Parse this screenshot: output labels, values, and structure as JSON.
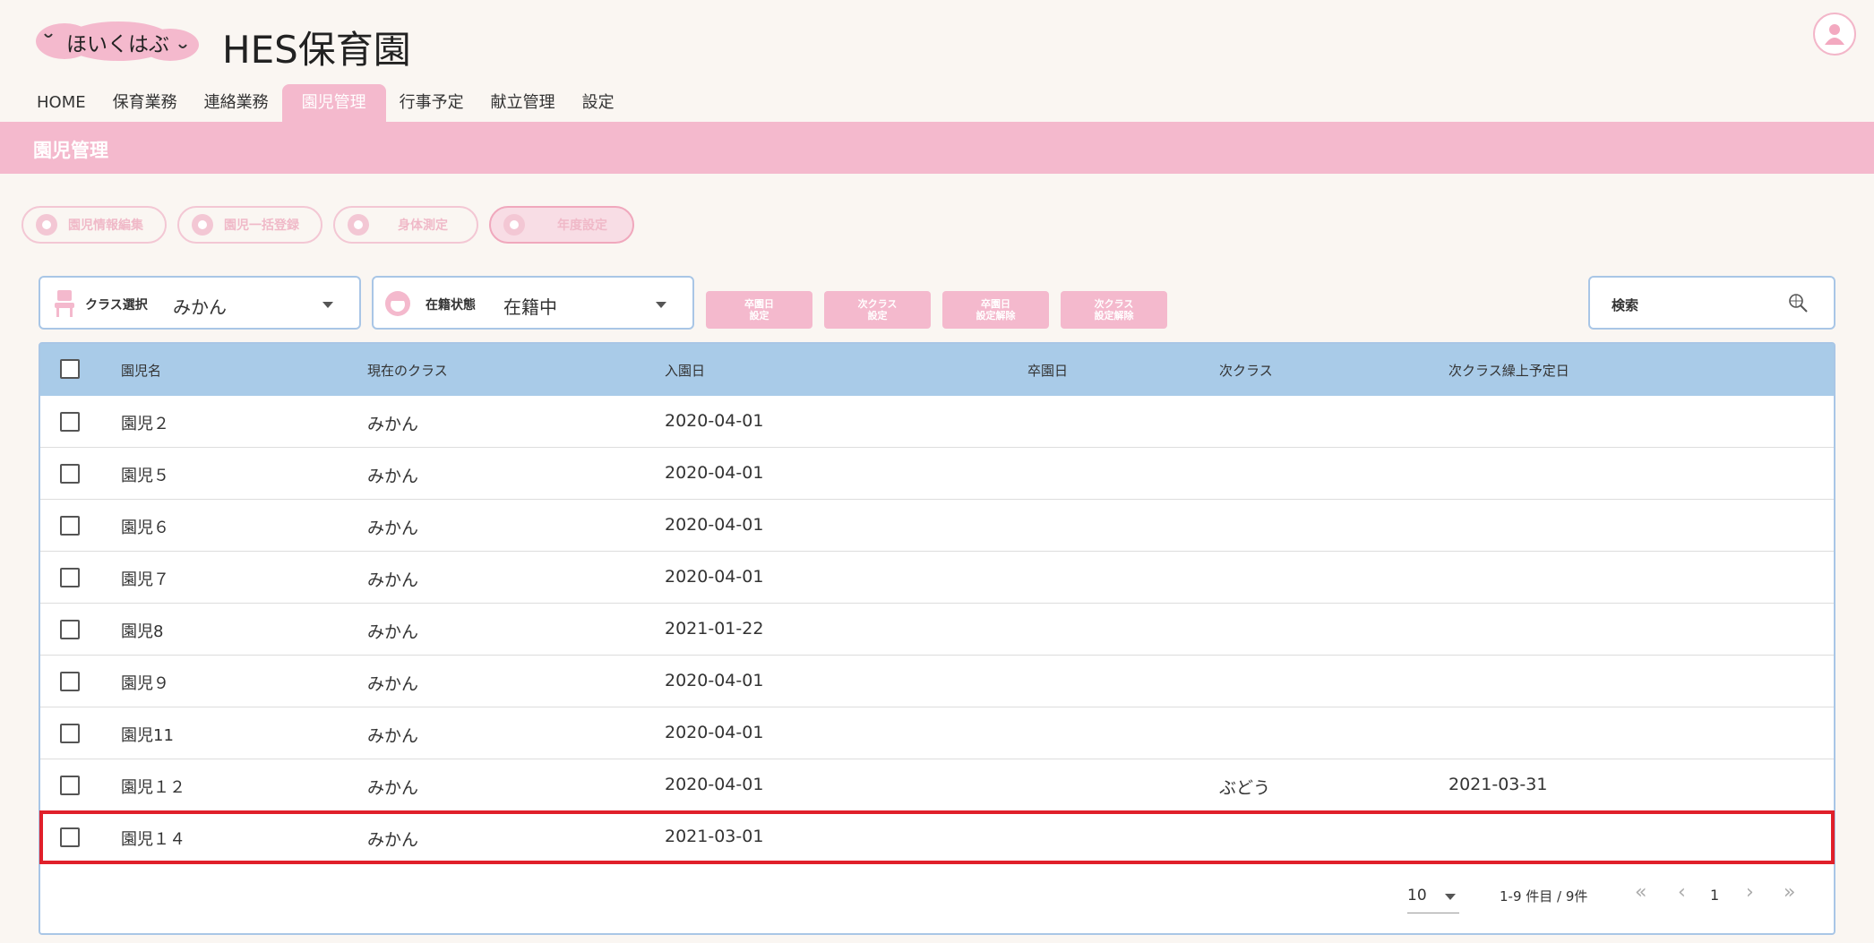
{
  "header": {
    "logo_text": "ほいくはぶ",
    "site_title": "HES保育園"
  },
  "nav": {
    "items": [
      {
        "label": "HOME"
      },
      {
        "label": "保育業務"
      },
      {
        "label": "連絡業務"
      },
      {
        "label": "園児管理",
        "active": true
      },
      {
        "label": "行事予定"
      },
      {
        "label": "献立管理"
      },
      {
        "label": "設定"
      }
    ]
  },
  "banner": {
    "title": "園児管理"
  },
  "actions": {
    "edit_label": "園児情報編集",
    "bulk_label": "園児一括登録",
    "measure_label": "身体測定",
    "year_label": "年度設定"
  },
  "filters": {
    "class_label": "クラス選択",
    "class_value": "みかん",
    "status_label": "在籍状態",
    "status_value": "在籍中"
  },
  "buttons": {
    "graduation_set": [
      "卒園日",
      "設定"
    ],
    "next_class_set": [
      "次クラス",
      "設定"
    ],
    "graduation_clear": [
      "卒園日",
      "設定解除"
    ],
    "next_class_clear": [
      "次クラス",
      "設定解除"
    ]
  },
  "search": {
    "label": "検索"
  },
  "table": {
    "columns": [
      "園児名",
      "現在のクラス",
      "入園日",
      "卒園日",
      "次クラス",
      "次クラス繰上予定日"
    ],
    "rows": [
      {
        "name": "園児２",
        "class": "みかん",
        "entry": "2020-04-01",
        "grad": "",
        "next": "",
        "next_date": ""
      },
      {
        "name": "園児５",
        "class": "みかん",
        "entry": "2020-04-01",
        "grad": "",
        "next": "",
        "next_date": ""
      },
      {
        "name": "園児６",
        "class": "みかん",
        "entry": "2020-04-01",
        "grad": "",
        "next": "",
        "next_date": ""
      },
      {
        "name": "園児７",
        "class": "みかん",
        "entry": "2020-04-01",
        "grad": "",
        "next": "",
        "next_date": ""
      },
      {
        "name": "園児8",
        "class": "みかん",
        "entry": "2021-01-22",
        "grad": "",
        "next": "",
        "next_date": ""
      },
      {
        "name": "園児９",
        "class": "みかん",
        "entry": "2020-04-01",
        "grad": "",
        "next": "",
        "next_date": ""
      },
      {
        "name": "園児11",
        "class": "みかん",
        "entry": "2020-04-01",
        "grad": "",
        "next": "",
        "next_date": ""
      },
      {
        "name": "園児１２",
        "class": "みかん",
        "entry": "2020-04-01",
        "grad": "",
        "next": "ぶどう",
        "next_date": "2021-03-31"
      },
      {
        "name": "園児１４",
        "class": "みかん",
        "entry": "2021-03-01",
        "grad": "",
        "next": "",
        "next_date": ""
      }
    ]
  },
  "pager": {
    "page_size": "10",
    "range": "1-9 件目 / 9件",
    "page": "1",
    "first": "«",
    "prev": "‹",
    "next": "›",
    "last": "»"
  },
  "colors": {
    "accent_pink": "#f4b9cd",
    "table_header_blue": "#a9cbe8",
    "highlight_red": "#e0202a"
  }
}
